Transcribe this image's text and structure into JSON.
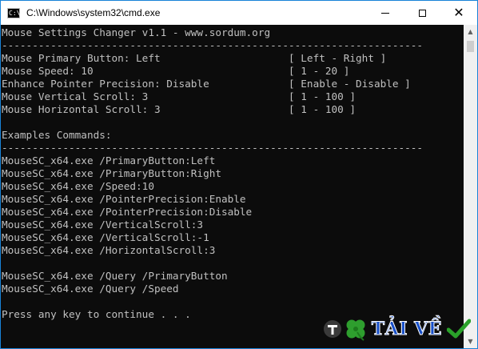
{
  "window": {
    "title": "C:\\Windows\\system32\\cmd.exe",
    "icon_text": "C:\\",
    "close_glyph": "✕"
  },
  "console": {
    "lines": [
      "Mouse Settings Changer v1.1 - www.sordum.org",
      "---------------------------------------------------------------------",
      "Mouse Primary Button: Left                     [ Left - Right ]",
      "Mouse Speed: 10                                [ 1 - 20 ]",
      "Enhance Pointer Precision: Disable             [ Enable - Disable ]",
      "Mouse Vertical Scroll: 3                       [ 1 - 100 ]",
      "Mouse Horizontal Scroll: 3                     [ 1 - 100 ]",
      "",
      "Examples Commands:",
      "---------------------------------------------------------------------",
      "MouseSC_x64.exe /PrimaryButton:Left",
      "MouseSC_x64.exe /PrimaryButton:Right",
      "MouseSC_x64.exe /Speed:10",
      "MouseSC_x64.exe /PointerPrecision:Enable",
      "MouseSC_x64.exe /PointerPrecision:Disable",
      "MouseSC_x64.exe /VerticalScroll:3",
      "MouseSC_x64.exe /VerticalScroll:-1",
      "MouseSC_x64.exe /HorizontalScroll:3",
      "",
      "MouseSC_x64.exe /Query /PrimaryButton",
      "MouseSC_x64.exe /Query /Speed",
      "",
      "Press any key to continue . . ."
    ]
  },
  "watermark": {
    "text": "TẢI VỀ"
  },
  "colors": {
    "accent": "#1883d7",
    "console_bg": "#0c0c0c",
    "console_fg": "#c0c0c0",
    "watermark_text": "#174fc9",
    "watermark_check": "#2aa12a"
  }
}
